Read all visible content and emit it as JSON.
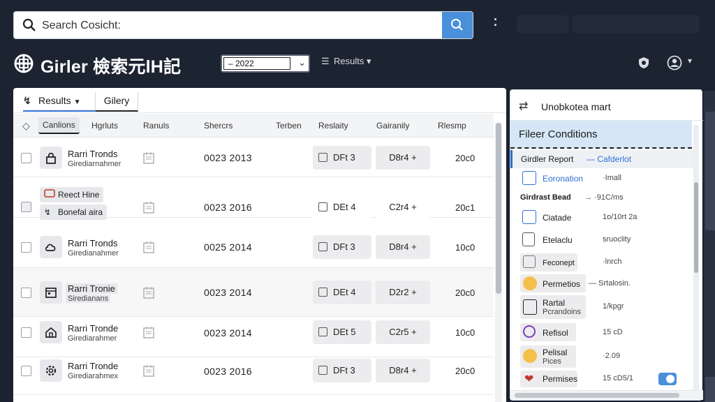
{
  "search": {
    "placeholder": "Search Cosicht:"
  },
  "brand": {
    "name": "Girler 檢索元lH記"
  },
  "year_select": {
    "value": "– 2022"
  },
  "nav": {
    "results_label": "Results"
  },
  "tabs": [
    {
      "label": "Results"
    },
    {
      "label": "Gilery"
    }
  ],
  "columns": [
    "Canlions",
    "Hgrluts",
    "Ranuls",
    "Shercrs",
    "Terben",
    "Reslaity",
    "Gairanily",
    "Rlesmp"
  ],
  "rows": [
    {
      "title": "Rarri Tronds",
      "subtitle": "Girediarnahmer",
      "date": "0023 2013",
      "tag1": "DFt 3",
      "tag2": "D8r4 +",
      "num": "20c0"
    },
    {
      "btn1": "Reect Hine",
      "btn2": "Bonefal aira",
      "date": "0023 2016",
      "tag1": "DEt 4",
      "tag2": "C2r4 +",
      "num": "20c1"
    },
    {
      "title": "Rarri Tronds",
      "subtitle": "Giredianahmer",
      "date": "0025 2014",
      "tag1": "DFt 3",
      "tag2": "D8r4 +",
      "num": "10c0"
    },
    {
      "title": "Rarri Tronie",
      "subtitle": "Siredianans",
      "date": "0023 2014",
      "tag1": "DEt 4",
      "tag2": "D2r2 +",
      "num": "20c0"
    },
    {
      "title": "Rarri Tronde",
      "subtitle": "Girediarahmer",
      "date": "0023 2014",
      "tag1": "DEt 5",
      "tag2": "C2r5 +",
      "num": "10c0"
    },
    {
      "title": "Rarri Tronde",
      "subtitle": "Girediarahmex",
      "date": "0023 2016",
      "tag1": "DFt 3",
      "tag2": "D8r4 +",
      "num": "20c0"
    }
  ],
  "side": {
    "header": "Unobkotea mart",
    "filter_title": "Fileer Conditions",
    "selected": {
      "label": "Girdler Report",
      "value": "— Cafderlot"
    },
    "items": [
      {
        "label": "Eoronation",
        "value": "·Imall",
        "color": "#2f6fd6"
      },
      {
        "label": "Girdrast Bead",
        "value": "→ ·91C/ms",
        "color": "#1b1b1b"
      },
      {
        "label": "Ciatade",
        "value": "1o/10rt 2a",
        "color": "#2f6fd6"
      },
      {
        "label": "Etelaclu",
        "value": "sruoclity",
        "color": "#555555"
      },
      {
        "label": "Feconept",
        "value": "·lnrch",
        "color": "#777777"
      },
      {
        "label": "Permetios",
        "value": "— Srtalosin.",
        "color": "#e0a12a"
      },
      {
        "label": "Rartal",
        "label2": "Pcrandoins",
        "value": "1/kpgr",
        "color": "#1b1b1b"
      },
      {
        "label": "Refisol",
        "value": "15 cD",
        "color": "#7a3cc2"
      },
      {
        "label": "Pelisal",
        "label2": "Pices",
        "value": "·2.09",
        "color": "#e0a12a"
      },
      {
        "label": "Permises",
        "value": "15 cD5/1",
        "color": "#c0392b"
      }
    ]
  }
}
